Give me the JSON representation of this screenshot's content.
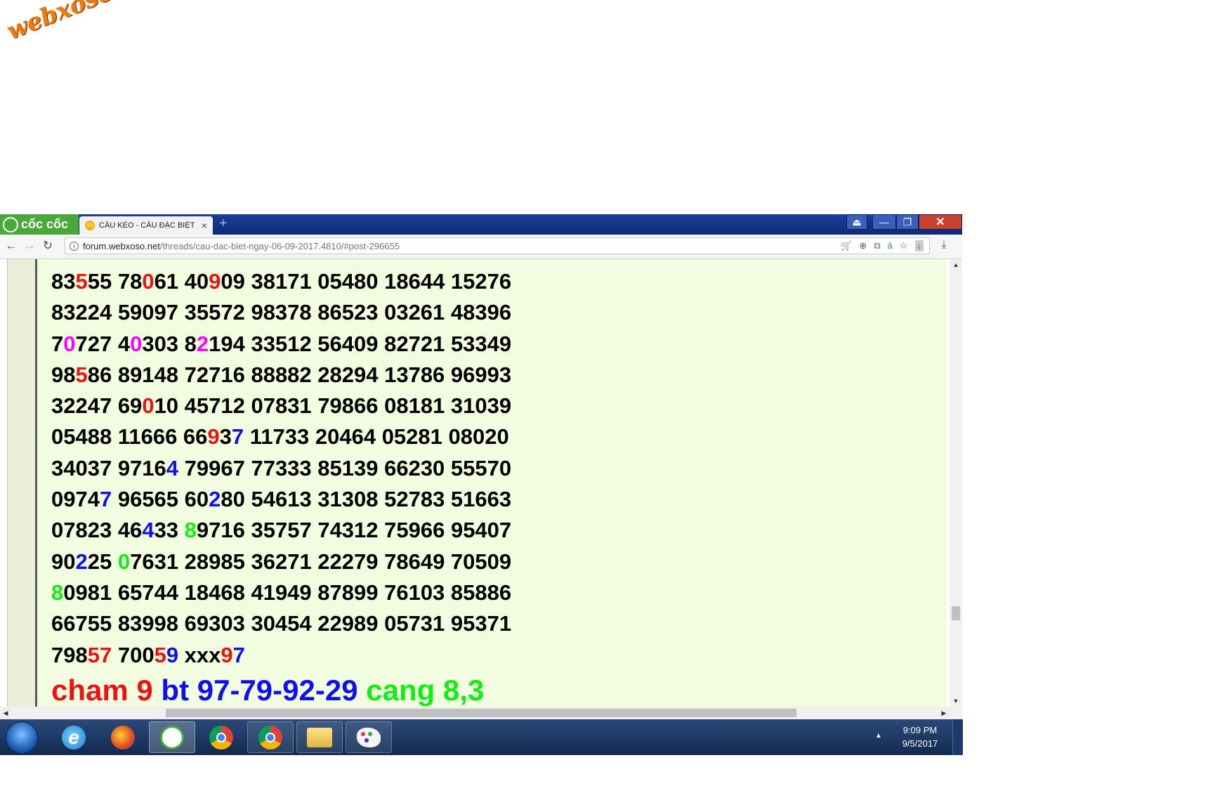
{
  "watermark": "webxoso.net",
  "browser": {
    "brand": "cốc cốc",
    "tab": {
      "title": "CẦU KÈO - CẦU ĐẶC BIỆT",
      "favicon": "XS",
      "close": "×"
    },
    "new_tab": "+",
    "window_controls": {
      "minimize": "—",
      "maximize": "❐",
      "close": "✕"
    },
    "url": {
      "host": "forum.webxoso.net",
      "path": "/threads/cau-dac-biet-ngay-06-09-2017.4810/#post-296655"
    },
    "icons": [
      "back-icon",
      "forward-icon",
      "reload-icon",
      "info-icon",
      "cart-icon",
      "zoom-icon",
      "translate-icon",
      "typing-icon",
      "star-icon",
      "download-icon"
    ]
  },
  "content": {
    "number_lines": [
      [
        [
          "83",
          ""
        ],
        [
          "5",
          "r"
        ],
        [
          "55 78",
          ""
        ],
        [
          "0",
          "r"
        ],
        [
          "61 40",
          ""
        ],
        [
          "9",
          "r"
        ],
        [
          "09 38171 05480 18644 15276",
          ""
        ]
      ],
      [
        [
          "83224 59097 35572 98378 86523 03261 48396",
          ""
        ]
      ],
      [
        [
          "7",
          ""
        ],
        [
          "0",
          "m"
        ],
        [
          "727 4",
          ""
        ],
        [
          "0",
          "m"
        ],
        [
          "303 8",
          ""
        ],
        [
          "2",
          "m"
        ],
        [
          "194 33512 56409 82721 53349",
          ""
        ]
      ],
      [
        [
          "98",
          ""
        ],
        [
          "5",
          "r"
        ],
        [
          "86 89148 72716 88882 28294 13786 96993",
          ""
        ]
      ],
      [
        [
          "32247 69",
          ""
        ],
        [
          "0",
          "r"
        ],
        [
          "10 45712 07831 79866 08181 31039",
          ""
        ]
      ],
      [
        [
          "05488 11666 66",
          ""
        ],
        [
          "9",
          "r"
        ],
        [
          "3",
          ""
        ],
        [
          "7",
          "b"
        ],
        [
          " 11733 20464 05281 08020",
          ""
        ]
      ],
      [
        [
          "34037 9716",
          ""
        ],
        [
          "4",
          "b"
        ],
        [
          " 79967 77333 85139 66230 55570",
          ""
        ]
      ],
      [
        [
          "0974",
          ""
        ],
        [
          "7",
          "b"
        ],
        [
          " 96565 60",
          ""
        ],
        [
          "2",
          "b"
        ],
        [
          "80 54613 31308 52783 51663",
          ""
        ]
      ],
      [
        [
          "07823 46",
          ""
        ],
        [
          "4",
          "b"
        ],
        [
          "33 ",
          ""
        ],
        [
          "8",
          "g"
        ],
        [
          "9716 35757 74312 75966 95407",
          ""
        ]
      ],
      [
        [
          "90",
          ""
        ],
        [
          "2",
          "b"
        ],
        [
          "25 ",
          ""
        ],
        [
          "0",
          "g"
        ],
        [
          "7631 28985 36271 22279 78649 70509",
          ""
        ]
      ],
      [
        [
          "8",
          "g"
        ],
        [
          "0981 65744 18468 41949 87899 76103 85886",
          ""
        ]
      ],
      [
        [
          "66755 83998 69303 30454 22989 05731 95371",
          ""
        ]
      ],
      [
        [
          "798",
          ""
        ],
        [
          "57",
          "r"
        ],
        [
          " 700",
          ""
        ],
        [
          "5",
          "r"
        ],
        [
          "9",
          "b"
        ],
        [
          " xxx",
          ""
        ],
        [
          "9",
          "r"
        ],
        [
          "7",
          "b"
        ]
      ]
    ],
    "summary": {
      "cham_label": "cham 9",
      "bt_label": "bt 97-79-92-29",
      "cang_label": "cang 8,3"
    }
  },
  "colors": {
    "red": "#ee1111",
    "magenta": "#ff00ff",
    "blue": "#1010ee",
    "green": "#11ee11",
    "post_bg": "#f2fde0"
  },
  "taskbar": {
    "apps": [
      "windows-start",
      "internet-explorer",
      "firefox",
      "coc-coc",
      "chrome",
      "chrome",
      "file-explorer",
      "paint"
    ],
    "clock": {
      "time": "9:09 PM",
      "date": "9/5/2017"
    }
  }
}
